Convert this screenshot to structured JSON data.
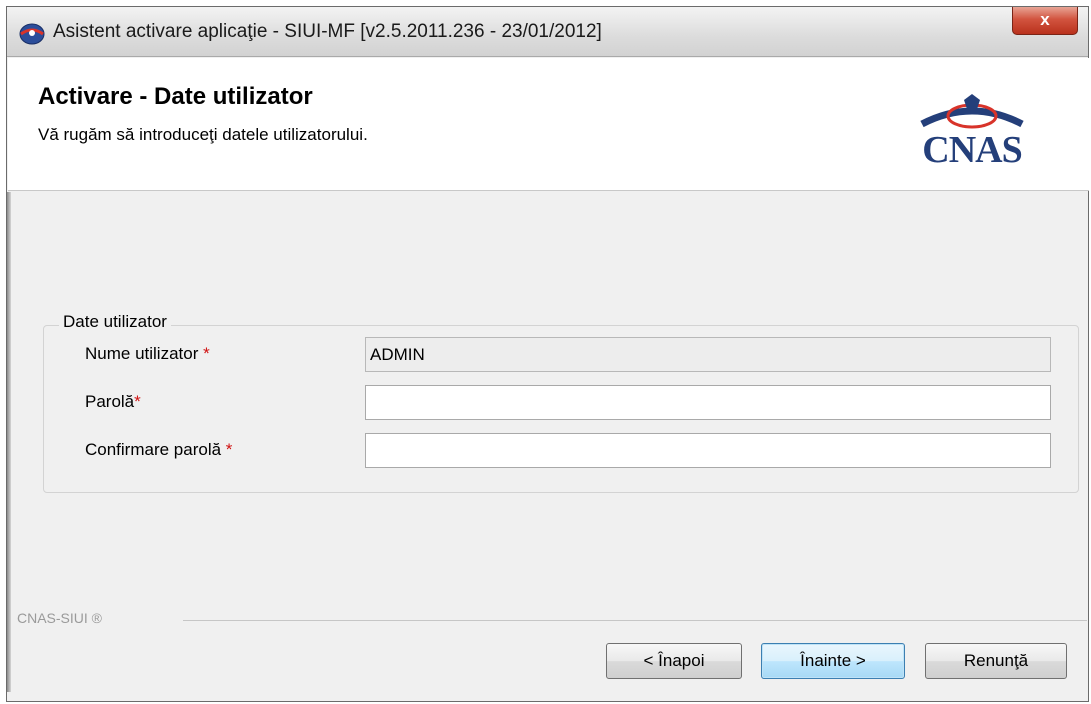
{
  "window": {
    "title": "Asistent activare aplicaţie - SIUI-MF [v2.5.2011.236 - 23/01/2012]",
    "close_label": "x"
  },
  "header": {
    "title": "Activare - Date utilizator",
    "subtitle": "Vă rugăm să introduceţi datele utilizatorului.",
    "logo_text": "CNAS"
  },
  "group": {
    "legend": "Date utilizator",
    "fields": [
      {
        "label": "Nume utilizator",
        "required_mark": "*",
        "value": "ADMIN",
        "disabled": true
      },
      {
        "label": "Parolă",
        "required_mark": "*",
        "value": "",
        "disabled": false
      },
      {
        "label": "Confirmare parolă",
        "required_mark": "*",
        "value": "",
        "disabled": false
      }
    ]
  },
  "footer": {
    "brand": "CNAS-SIUI ®"
  },
  "buttons": {
    "back": "< Înapoi",
    "next": "Înainte >",
    "cancel": "Renunţă"
  },
  "colors": {
    "required": "#d01010",
    "logo": "#243f7a",
    "primary_button_border": "#3c7fb1"
  }
}
